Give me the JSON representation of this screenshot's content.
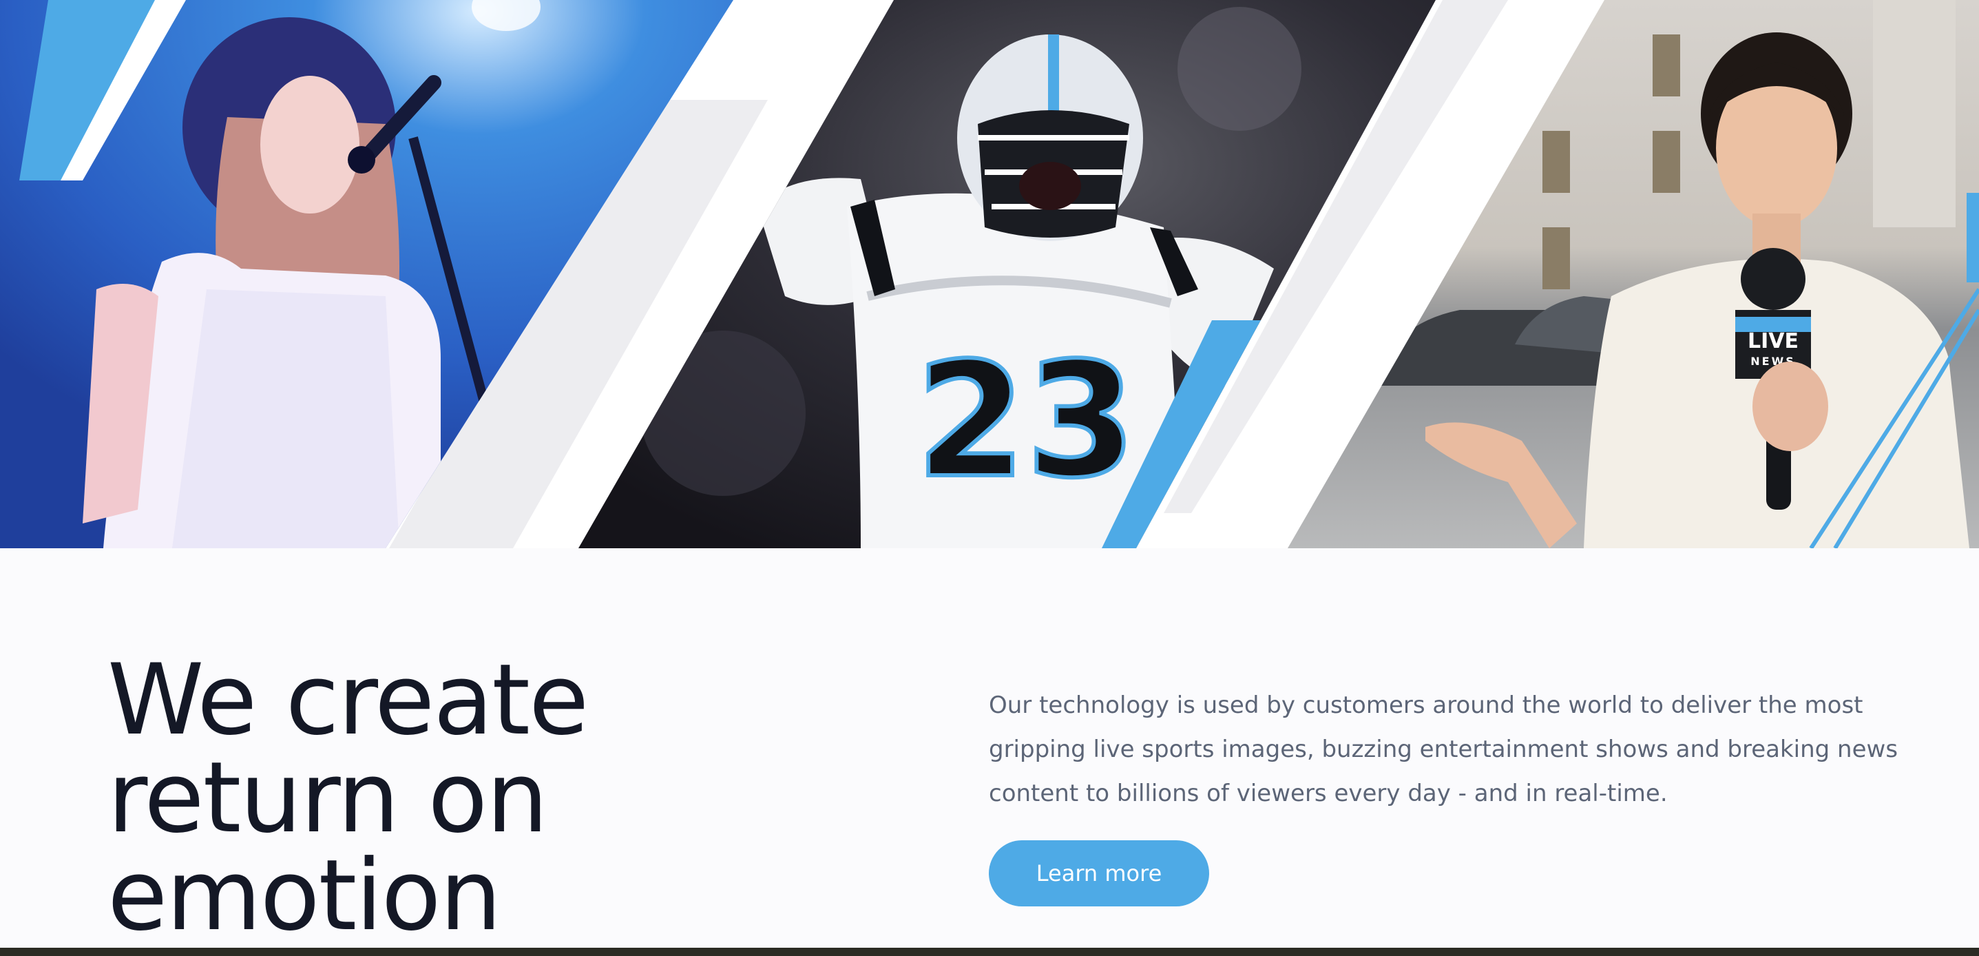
{
  "hero": {
    "panels": [
      {
        "name": "singer-photo",
        "subject": "concert singer at microphone"
      },
      {
        "name": "football-player-photo",
        "subject": "football player celebrating",
        "jersey_number": "23"
      },
      {
        "name": "news-reporter-photo",
        "subject": "news reporter with microphone",
        "mic_flag_top": "LIVE",
        "mic_flag_bottom": "NEWS"
      }
    ],
    "colors": {
      "accent_blue": "#4eaae6",
      "stripe_gray": "#ededf0"
    }
  },
  "content": {
    "headline": [
      "We create",
      "return on",
      "emotion"
    ],
    "description": [
      "Our technology is used by customers around the world to deliver the most",
      "gripping live sports images, buzzing entertainment shows and breaking news",
      "content to billions of viewers every day - and in real-time."
    ],
    "learn_more_label": "Learn more"
  }
}
